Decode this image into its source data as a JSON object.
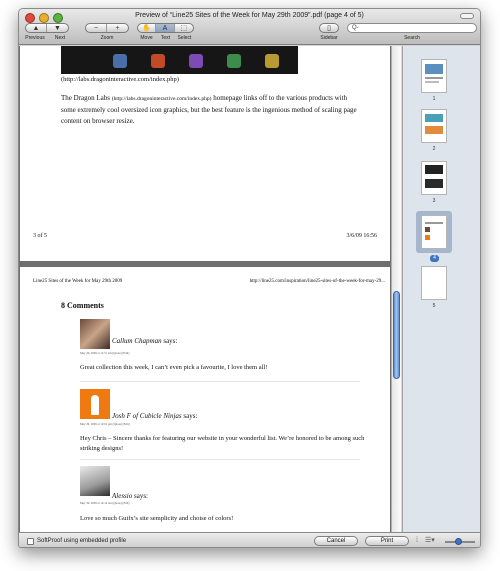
{
  "window": {
    "title": "Preview of “Line25 Sites of the Week for May 29th 2009”.pdf (page 4 of 5)"
  },
  "toolbar": {
    "previous_label": "Previous",
    "next_label": "Next",
    "zoom_label": "Zoom",
    "move_label": "Move",
    "text_label": "Text",
    "select_label": "Select",
    "sidebar_label": "Sidebar",
    "search_label": "Search",
    "search_placeholder": "Q-"
  },
  "page3": {
    "caption": "(http://labs.dragoninteractive.com/index.php)",
    "paragraph_lead": "The Dragon Labs ",
    "paragraph_link": "(http://labs.dragoninteractive.com/index.php)",
    "paragraph_rest": " homepage links off to the various products with some extremely cool oversized icon graphics, but the best feature is the ingenious method of scaling page content on browser resize.",
    "footer_left": "3 of 5",
    "footer_right": "3/6/09 16:56"
  },
  "page4": {
    "header_left": "Line25 Sites of the Week for May 29th 2009",
    "header_right": "http://line25.com/inspiration/line25-sites-of-the-week-for-may-29...",
    "comments_heading": "8 Comments",
    "comments": [
      {
        "name": "Callum Chapman",
        "says": " says:",
        "meta": "May 29, 2009 at 11:51 am (Quote) (Edit)",
        "text": "Great collection this week, I can’t even pick a favourite, I love them all!"
      },
      {
        "name": "Josh F of Cubicle Ninjas",
        "says": " says:",
        "meta": "May 29, 2009 at 12:01 pm (Quote) (Edit)",
        "text": "Hey Chris – Sincere thanks for featuring our website in your wonderful list. We’re honored to be among such striking designs!"
      },
      {
        "name": "Alessio",
        "says": " says:",
        "meta": "May 30, 2009 at 12:14 am (Quote) (Edit)",
        "text": "Love so much Guifx’s site semplicity and choise of colors!"
      }
    ]
  },
  "sidebar": {
    "pages": [
      "1",
      "2",
      "3",
      "4",
      "5"
    ],
    "selected_page": "4"
  },
  "bottom": {
    "softproof_label": "SoftProof using embedded profile",
    "cancel_label": "Cancel",
    "print_label": "Print"
  },
  "colors": {
    "accent": "#3f73c4",
    "light_close": "#e2483f",
    "light_min": "#e7b12b",
    "light_zoom": "#59b33f",
    "josh_avatar": "#f07a12"
  }
}
